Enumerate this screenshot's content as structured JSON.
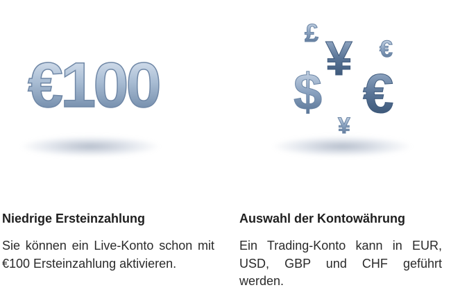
{
  "feature_low_deposit": {
    "graphic_text": "€100",
    "title": "Niedrige Ersteinzahlung",
    "description": "Sie können ein Live-Konto schon mit €100 Ersteinzahlung aktivieren."
  },
  "feature_currency": {
    "symbols": {
      "pound": "£",
      "yen_large": "¥",
      "euro_small": "€",
      "dollar": "$",
      "euro_large": "€",
      "yen_small": "¥"
    },
    "title": "Auswahl der Kontowährung",
    "description": "Ein Trading-Konto kann in EUR, USD, GBP und CHF geführt werden."
  },
  "colors": {
    "symbol_light": "#c9d6e6",
    "symbol_mid": "#7c95b3",
    "symbol_dark": "#3f5a7c",
    "text": "#222222"
  }
}
